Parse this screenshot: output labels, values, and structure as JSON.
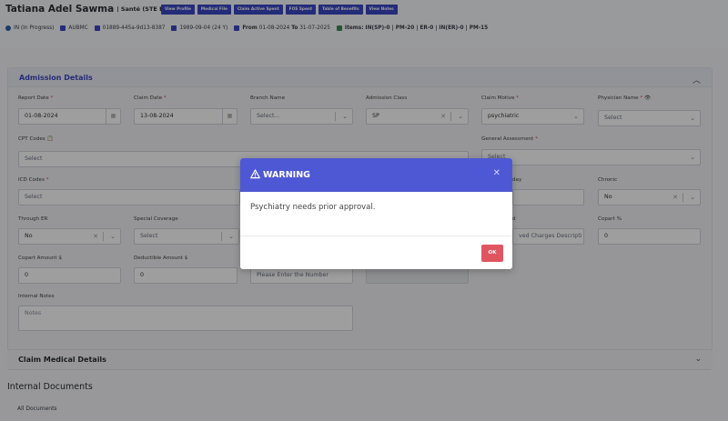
{
  "header": {
    "patient_name": "Tatiana Adel Sawma",
    "plan": "| Santé (STE Plus)",
    "buttons": [
      "View Profile",
      "Medical File",
      "Claim Active Spent",
      "FOS Spent",
      "Table of Benefits",
      "View Notes"
    ],
    "status": "IN (In Progress)",
    "hospital": "AUBMC",
    "claim_id": "01889-445a-9d13-8387",
    "dob": "1989-09-04 (24 Y)",
    "from_label": "From",
    "from_date": "01-08-2024",
    "to_label": "To",
    "to_date": "31-07-2025",
    "items_label": "Items:",
    "items": "IN(SP)-0 | PM-20 | ER-0 | IN(ER)-0 | PM-15"
  },
  "admission": {
    "title": "Admission Details",
    "report_date": {
      "label": "Report Date",
      "value": "01-08-2024"
    },
    "claim_date": {
      "label": "Claim Date",
      "value": "13-08-2024"
    },
    "branch_name": {
      "label": "Branch Name",
      "placeholder": "Select..."
    },
    "admission_class": {
      "label": "Admission Class",
      "value": "SP"
    },
    "claim_motive": {
      "label": "Claim Motive",
      "value": "psychiatric"
    },
    "physician_name": {
      "label": "Physician Name",
      "placeholder": "Select"
    },
    "cpt_codes": {
      "label": "CPT Codes",
      "placeholder": "Select"
    },
    "general_assessment": {
      "label": "General Assessment",
      "placeholder": "Select"
    },
    "icd_codes": {
      "label": "ICD Codes",
      "placeholder": "Select"
    },
    "day_label": "day",
    "chronic": {
      "label": "Chronic",
      "value": "No"
    },
    "through_er": {
      "label": "Through ER",
      "value": "No"
    },
    "special_coverage": {
      "label": "Special Coverage",
      "placeholder": "Select"
    },
    "approved_label": "d",
    "approved_placeholder": "ved Charges Descripti",
    "copart_pct": {
      "label": "Copart %",
      "value": "0"
    },
    "copart_amount": {
      "label": "Copart Amount $",
      "value": "0"
    },
    "deductible_amount": {
      "label": "Deductible Amount $",
      "value": "0"
    },
    "number_placeholder": "Please Enter the Number",
    "internal_notes": {
      "label": "Internal Notes",
      "placeholder": "Notes"
    }
  },
  "claim_medical": {
    "title": "Claim Medical Details"
  },
  "documents": {
    "title": "Internal Documents",
    "all": "All Documents"
  },
  "modal": {
    "title": "WARNING",
    "message": "Psychiatry needs prior approval.",
    "ok": "OK"
  },
  "colors": {
    "accent": "#3b48c4",
    "modal_header": "#4f58d4",
    "ok_button": "#e05560"
  }
}
